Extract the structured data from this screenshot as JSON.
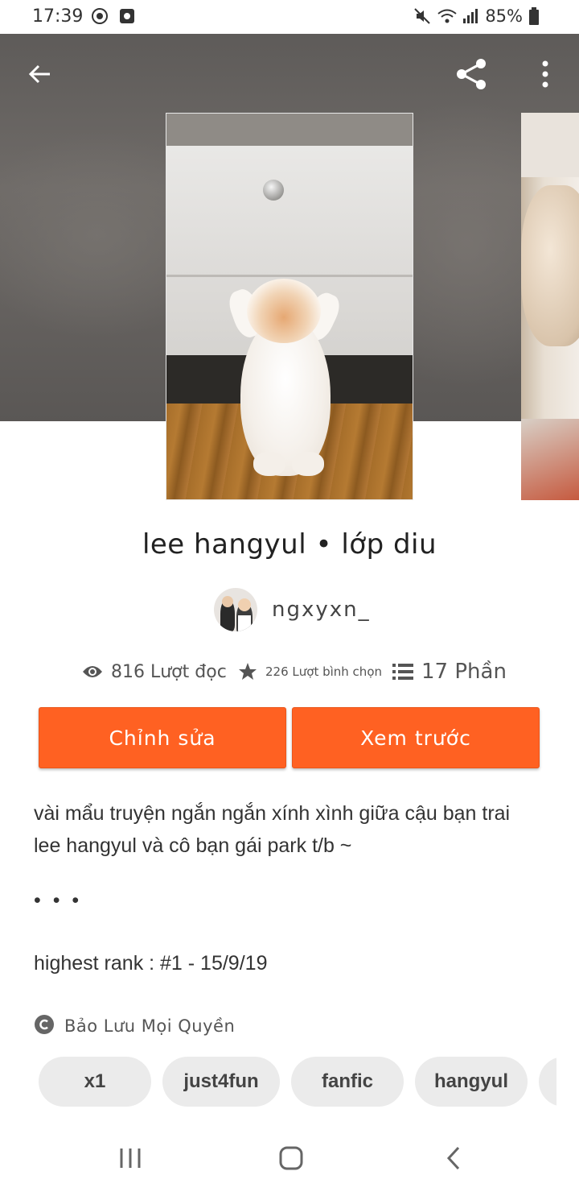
{
  "status_bar": {
    "time": "17:39",
    "battery": "85%",
    "icons": [
      "media-icon",
      "screen-record-icon",
      "mute-icon",
      "wifi-icon",
      "signal-icon",
      "battery-icon"
    ]
  },
  "header": {
    "back_icon": "arrow-left-icon",
    "share_icon": "share-icon",
    "more_icon": "more-vertical-icon"
  },
  "story": {
    "title": "lee hangyul • lớp diu",
    "author": "ngxyxn_",
    "stats": {
      "reads": "816 Lượt đọc",
      "votes": "226 Lượt bình chọn",
      "parts": "17 Phần"
    }
  },
  "actions": {
    "edit_label": "Chỉnh sửa",
    "preview_label": "Xem trước"
  },
  "description": {
    "line1": "vài mẩu truyện ngắn ngắn xính xình giữa cậu bạn trai",
    "line2": "lee hangyul và cô bạn gái park t/b ~",
    "dots": "• • •",
    "rank": "highest rank : #1  -  15/9/19"
  },
  "copyright": {
    "label": "Bảo Lưu Mọi Quyền"
  },
  "tags": [
    "x1",
    "just4fun",
    "fanfic",
    "hangyul",
    ""
  ],
  "colors": {
    "accent": "#ff6122",
    "header_bg": "#5e5b59",
    "tag_bg": "#ebebeb"
  }
}
